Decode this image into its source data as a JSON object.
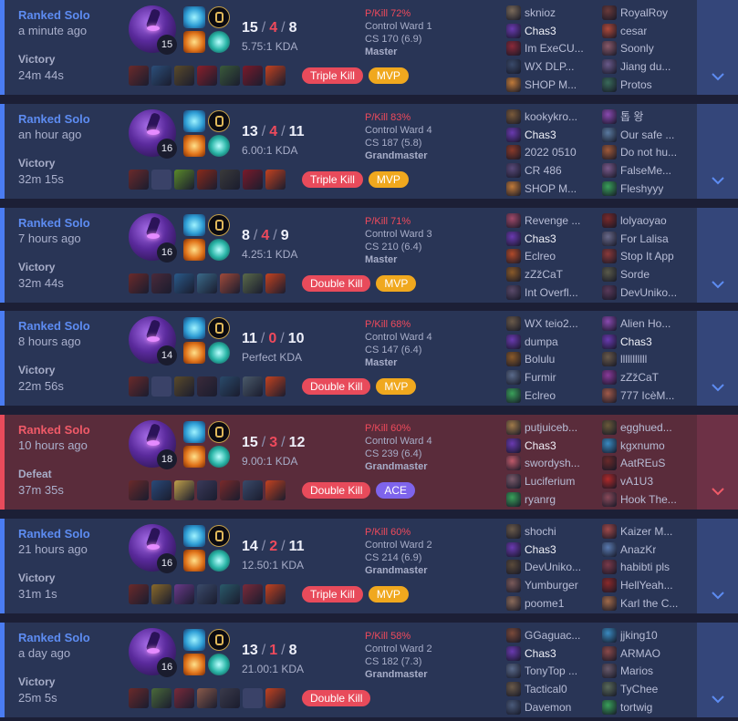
{
  "ui": {
    "kda_sep": "/"
  },
  "colors": {
    "win_stripe": "#4a7cf2",
    "loss_stripe": "#e84b5b",
    "deaths": "#ef4a5c",
    "mvp": "#f0a81e",
    "ace": "#7e64ec",
    "multikill": "#e84b5b"
  },
  "icons": {
    "expand": "chevron-down-icon",
    "spell_1": "flash-icon",
    "spell_2": "ignite-icon",
    "keystone": "keystone-rune-icon",
    "secondary": "secondary-rune-icon"
  },
  "matches": [
    {
      "result": "win",
      "queue": "Ranked Solo",
      "time_ago": "a minute ago",
      "outcome": "Victory",
      "duration": "24m 44s",
      "level": "15",
      "kills": "15",
      "deaths": "4",
      "assists": "8",
      "kda": "5.75:1 KDA",
      "pkill": "P/Kill 72%",
      "control_ward": "Control Ward 1",
      "cs": "CS 170 (6.9)",
      "tier": "Master",
      "multikill": "Triple Kill",
      "award": "MVP",
      "award_type": "mvp",
      "items": [
        "#6b2a2a",
        "#2c4f7a",
        "#5a4a2a",
        "#8a1f2a",
        "#3a5a3a",
        "#7a1a2a",
        "#c4421f"
      ],
      "team1": [
        {
          "name": "sknioz",
          "c": "#7a6a5a"
        },
        {
          "name": "Chas3",
          "c": "#6a3ab0",
          "me": true
        },
        {
          "name": "Im ExeCU...",
          "c": "#8a2a3a"
        },
        {
          "name": "WX DLP...",
          "c": "#3a4a6a"
        },
        {
          "name": "SHOP M...",
          "c": "#c07a3a"
        }
      ],
      "team2": [
        {
          "name": "RoyalRoy",
          "c": "#6a3a3a"
        },
        {
          "name": "cesar",
          "c": "#b04a3a"
        },
        {
          "name": "Soonly",
          "c": "#8a5a6a"
        },
        {
          "name": "Jiang du...",
          "c": "#6a5a8a"
        },
        {
          "name": "Protos",
          "c": "#3a6a5a"
        }
      ]
    },
    {
      "result": "win",
      "queue": "Ranked Solo",
      "time_ago": "an hour ago",
      "outcome": "Victory",
      "duration": "32m 15s",
      "level": "16",
      "kills": "13",
      "deaths": "4",
      "assists": "11",
      "kda": "6.00:1 KDA",
      "pkill": "P/Kill 83%",
      "control_ward": "Control Ward 4",
      "cs": "CS 187 (5.8)",
      "tier": "Grandmaster",
      "multikill": "Triple Kill",
      "award": "MVP",
      "award_type": "mvp",
      "items": [
        "#6b2a2a",
        "empty",
        "#5a8a2a",
        "#8a2a1a",
        "#3a3a3a",
        "#7a1a2a",
        "#c4421f"
      ],
      "team1": [
        {
          "name": "kookykro...",
          "c": "#7a5a3a"
        },
        {
          "name": "Chas3",
          "c": "#6a3ab0",
          "me": true
        },
        {
          "name": "2022 0510",
          "c": "#8a3a2a"
        },
        {
          "name": "CR 486",
          "c": "#5a4a7a"
        },
        {
          "name": "SHOP M...",
          "c": "#c07a3a"
        }
      ],
      "team2": [
        {
          "name": "톱 왕",
          "c": "#8a4ab0"
        },
        {
          "name": "Our safe ...",
          "c": "#5a7aa0"
        },
        {
          "name": "Do not hu...",
          "c": "#a05a3a"
        },
        {
          "name": "FalseMe...",
          "c": "#7a5a8a"
        },
        {
          "name": "Fleshyyy",
          "c": "#3aa05a"
        }
      ]
    },
    {
      "result": "win",
      "queue": "Ranked Solo",
      "time_ago": "7 hours ago",
      "outcome": "Victory",
      "duration": "32m 44s",
      "level": "16",
      "kills": "8",
      "deaths": "4",
      "assists": "9",
      "kda": "4.25:1 KDA",
      "pkill": "P/Kill 71%",
      "control_ward": "Control Ward 3",
      "cs": "CS 210 (6.4)",
      "tier": "Master",
      "multikill": "Double Kill",
      "award": "MVP",
      "award_type": "mvp",
      "items": [
        "#6b2a2a",
        "#4a2a3a",
        "#2a5a8a",
        "#3a6a8a",
        "#a04a3a",
        "#5a6a4a",
        "#c4421f"
      ],
      "team1": [
        {
          "name": "Revenge ...",
          "c": "#a04a6a"
        },
        {
          "name": "Chas3",
          "c": "#6a3ab0",
          "me": true
        },
        {
          "name": "Eclreo",
          "c": "#b04a2a"
        },
        {
          "name": "zZžCaT",
          "c": "#8a5a2a"
        },
        {
          "name": "Int Overfl...",
          "c": "#5a4a6a"
        }
      ],
      "team2": [
        {
          "name": "lolyaoyao",
          "c": "#7a2a2a"
        },
        {
          "name": "For Lalisa",
          "c": "#6a6a8a"
        },
        {
          "name": "Stop It App",
          "c": "#8a3a3a"
        },
        {
          "name": "Sorde",
          "c": "#5a5a4a"
        },
        {
          "name": "DevUniko...",
          "c": "#5a3a5a"
        }
      ]
    },
    {
      "result": "win",
      "queue": "Ranked Solo",
      "time_ago": "8 hours ago",
      "outcome": "Victory",
      "duration": "22m 56s",
      "level": "14",
      "kills": "11",
      "deaths": "0",
      "assists": "10",
      "kda": "Perfect KDA",
      "pkill": "P/Kill 68%",
      "control_ward": "Control Ward 4",
      "cs": "CS 147 (6.4)",
      "tier": "Master",
      "multikill": "Double Kill",
      "award": "MVP",
      "award_type": "mvp",
      "items": [
        "#6b2a2a",
        "empty",
        "#5a4a2a",
        "#3a2a3a",
        "#2a4a6a",
        "#4a5a6a",
        "#c4421f"
      ],
      "team1": [
        {
          "name": "WX teio2...",
          "c": "#6a5a4a"
        },
        {
          "name": "dumpa",
          "c": "#6a3ab0"
        },
        {
          "name": "Bolulu",
          "c": "#8a5a2a"
        },
        {
          "name": "Furmir",
          "c": "#5a6a8a"
        },
        {
          "name": "Eclreo",
          "c": "#3aa05a"
        }
      ],
      "team2": [
        {
          "name": "Alien Ho...",
          "c": "#8a4ab0"
        },
        {
          "name": "Chas3",
          "c": "#6a3ab0",
          "me": true
        },
        {
          "name": "lllllllllll",
          "c": "#6a5a4a"
        },
        {
          "name": "zZžCaT",
          "c": "#8a3a9a"
        },
        {
          "name": "777 IcèM...",
          "c": "#a05a4a"
        }
      ]
    },
    {
      "result": "loss",
      "queue": "Ranked Solo",
      "time_ago": "10 hours ago",
      "outcome": "Defeat",
      "duration": "37m 35s",
      "level": "18",
      "kills": "15",
      "deaths": "3",
      "assists": "12",
      "kda": "9.00:1 KDA",
      "pkill": "P/Kill 60%",
      "control_ward": "Control Ward 4",
      "cs": "CS 239 (6.4)",
      "tier": "Grandmaster",
      "multikill": "Double Kill",
      "award": "ACE",
      "award_type": "ace",
      "items": [
        "#6b2a2a",
        "#2a4a7a",
        "#c0a04a",
        "#3a3a5a",
        "#7a2a2a",
        "#3a4a6a",
        "#c4421f"
      ],
      "team1": [
        {
          "name": "putjuiceb...",
          "c": "#a07a4a"
        },
        {
          "name": "Chas3",
          "c": "#6a3ab0",
          "me": true
        },
        {
          "name": "swordysh...",
          "c": "#c05a6a"
        },
        {
          "name": "Luciferium",
          "c": "#7a5a6a"
        },
        {
          "name": "ryanrg",
          "c": "#3aa05a"
        }
      ],
      "team2": [
        {
          "name": "egghued...",
          "c": "#6a5a3a"
        },
        {
          "name": "kgxnumo",
          "c": "#3a8ac0"
        },
        {
          "name": "AatREuS",
          "c": "#6a2a2a"
        },
        {
          "name": "vA1U3",
          "c": "#b02a2a"
        },
        {
          "name": "Hook The...",
          "c": "#8a4a5a"
        }
      ]
    },
    {
      "result": "win",
      "queue": "Ranked Solo",
      "time_ago": "21 hours ago",
      "outcome": "Victory",
      "duration": "31m 1s",
      "level": "16",
      "kills": "14",
      "deaths": "2",
      "assists": "11",
      "kda": "12.50:1 KDA",
      "pkill": "P/Kill 60%",
      "control_ward": "Control Ward 2",
      "cs": "CS 214 (6.9)",
      "tier": "Grandmaster",
      "multikill": "Triple Kill",
      "award": "MVP",
      "award_type": "mvp",
      "items": [
        "#6b2a2a",
        "#8a6a2a",
        "#6a3a8a",
        "#3a4a6a",
        "#2a5a6a",
        "#7a2a3a",
        "#c4421f"
      ],
      "team1": [
        {
          "name": "shochi",
          "c": "#6a5a4a"
        },
        {
          "name": "Chas3",
          "c": "#6a3ab0",
          "me": true
        },
        {
          "name": "DevUniko...",
          "c": "#5a4a3a"
        },
        {
          "name": "Yumburger",
          "c": "#7a5a5a"
        },
        {
          "name": "poome1",
          "c": "#8a6a5a"
        }
      ],
      "team2": [
        {
          "name": "Kaizer M...",
          "c": "#a04a4a"
        },
        {
          "name": "AnazKr",
          "c": "#5a7ab0"
        },
        {
          "name": "habibti pls",
          "c": "#7a3a4a"
        },
        {
          "name": "HellYeah...",
          "c": "#8a2a2a"
        },
        {
          "name": "Karl the C...",
          "c": "#a06a4a"
        }
      ]
    },
    {
      "result": "win",
      "queue": "Ranked Solo",
      "time_ago": "a day ago",
      "outcome": "Victory",
      "duration": "25m 5s",
      "level": "16",
      "kills": "13",
      "deaths": "1",
      "assists": "8",
      "kda": "21.00:1 KDA",
      "pkill": "P/Kill 58%",
      "control_ward": "Control Ward 2",
      "cs": "CS 182 (7.3)",
      "tier": "Grandmaster",
      "multikill": "Double Kill",
      "award": "",
      "award_type": "none",
      "items": [
        "#6b2a2a",
        "#4a6a3a",
        "#7a2a3a",
        "#8a5a4a",
        "#3a3a4a",
        "empty",
        "#c4421f"
      ],
      "team1": [
        {
          "name": "GGaguac...",
          "c": "#7a4a3a"
        },
        {
          "name": "Chas3",
          "c": "#6a3ab0",
          "me": true
        },
        {
          "name": "TonyTop ...",
          "c": "#5a6a8a"
        },
        {
          "name": "Tactical0",
          "c": "#6a5a4a"
        },
        {
          "name": "Davemon",
          "c": "#4a5a7a"
        }
      ],
      "team2": [
        {
          "name": "jjking10",
          "c": "#3a8ac0"
        },
        {
          "name": "ARMAO",
          "c": "#8a4a4a"
        },
        {
          "name": "Marios",
          "c": "#6a5a6a"
        },
        {
          "name": "TyChee",
          "c": "#5a6a5a"
        },
        {
          "name": "tortwig",
          "c": "#3aa05a"
        }
      ]
    }
  ]
}
